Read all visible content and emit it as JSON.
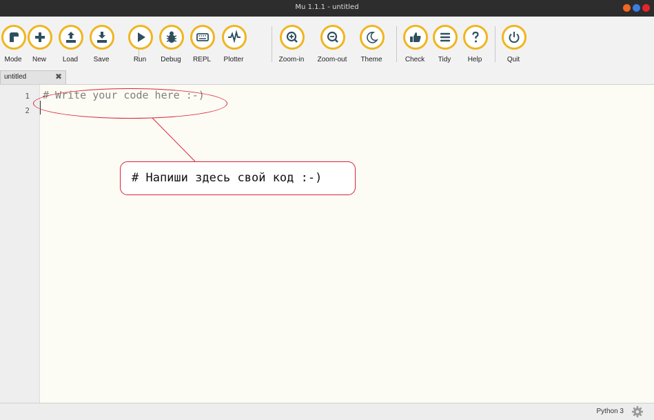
{
  "window": {
    "title": "Mu 1.1.1 - untitled",
    "controls": [
      {
        "name": "minimize",
        "color": "#f26722"
      },
      {
        "name": "maximize",
        "color": "#3d7de1"
      },
      {
        "name": "close",
        "color": "#e8242b"
      }
    ]
  },
  "toolbar": {
    "accent_color": "#f0b51e",
    "buttons": [
      {
        "id": "mode",
        "label": "Mode",
        "icon": "mode-icon"
      },
      {
        "id": "new",
        "label": "New",
        "icon": "plus-icon"
      },
      {
        "id": "load",
        "label": "Load",
        "icon": "upload-icon"
      },
      {
        "id": "save",
        "label": "Save",
        "icon": "download-icon"
      },
      {
        "id": "run",
        "label": "Run",
        "icon": "play-icon"
      },
      {
        "id": "debug",
        "label": "Debug",
        "icon": "bug-icon"
      },
      {
        "id": "repl",
        "label": "REPL",
        "icon": "keyboard-icon"
      },
      {
        "id": "plotter",
        "label": "Plotter",
        "icon": "pulse-icon"
      },
      {
        "id": "zoom_in",
        "label": "Zoom-in",
        "icon": "zoom-in-icon"
      },
      {
        "id": "zoom_out",
        "label": "Zoom-out",
        "icon": "zoom-out-icon"
      },
      {
        "id": "theme",
        "label": "Theme",
        "icon": "moon-icon"
      },
      {
        "id": "check",
        "label": "Check",
        "icon": "thumbs-up-icon"
      },
      {
        "id": "tidy",
        "label": "Tidy",
        "icon": "list-icon"
      },
      {
        "id": "help",
        "label": "Help",
        "icon": "question-icon"
      },
      {
        "id": "quit",
        "label": "Quit",
        "icon": "power-icon"
      }
    ]
  },
  "tabs": [
    {
      "label": "untitled",
      "close_glyph": "✖"
    }
  ],
  "editor": {
    "line_numbers": [
      "1",
      "2"
    ],
    "lines": [
      "# Write your code here :-)",
      ""
    ]
  },
  "annotation": {
    "text": "# Напиши здесь свой код :-)",
    "color": "#d8213b"
  },
  "status": {
    "mode": "Python 3",
    "settings_icon": "gear-icon"
  }
}
